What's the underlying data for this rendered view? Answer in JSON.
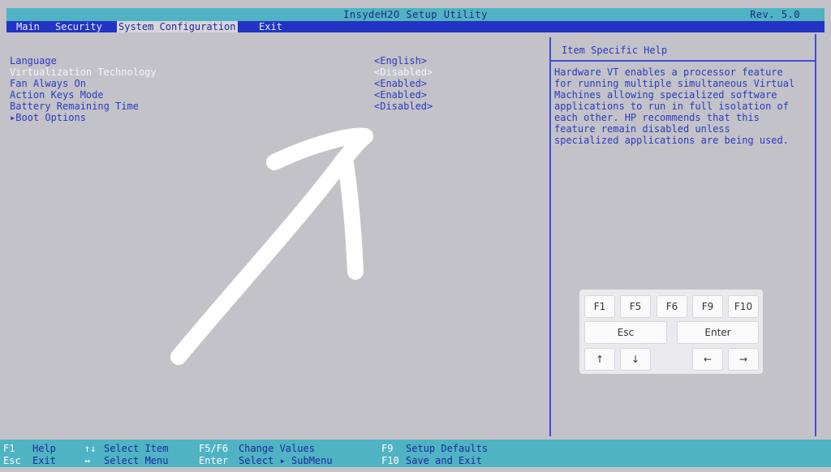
{
  "window": {
    "title": "InsydeH2O Setup Utility",
    "revision": "Rev. 5.0"
  },
  "menu": {
    "items": [
      {
        "label": "Main"
      },
      {
        "label": "Security"
      },
      {
        "label": "System Configuration"
      },
      {
        "label": "Exit"
      }
    ]
  },
  "settings": {
    "rows": [
      {
        "label": "Language",
        "value": "<English>"
      },
      {
        "label": "Virtualization Technology",
        "value": "<Disabled>"
      },
      {
        "label": "Fan Always On",
        "value": "<Enabled>"
      },
      {
        "label": "Action Keys Mode",
        "value": "<Enabled>"
      },
      {
        "label": "Battery Remaining Time",
        "value": "<Disabled>"
      },
      {
        "label": "▸Boot Options",
        "value": ""
      }
    ]
  },
  "help": {
    "title": "Item Specific Help",
    "lines": [
      "Hardware VT enables a processor feature",
      "for running multiple simultaneous Virtual",
      "Machines allowing specialized software",
      "applications to run in full isolation of",
      "each other. HP recommends that this",
      "feature remain disabled unless",
      "specialized applications are being used."
    ]
  },
  "footer": {
    "items": [
      {
        "key": "F1",
        "desc": "Help"
      },
      {
        "key": "Esc",
        "desc": "Exit"
      },
      {
        "key": "↑↓",
        "desc": "Select Item"
      },
      {
        "key": "↔",
        "desc": "Select Menu"
      },
      {
        "key": "F5/F6",
        "desc": "Change Values"
      },
      {
        "key": "Enter",
        "desc": "Select ▸ SubMenu"
      },
      {
        "key": "F9",
        "desc": "Setup Defaults"
      },
      {
        "key": "F10",
        "desc": "Save and Exit"
      }
    ]
  },
  "onscreen_keyboard": {
    "keys": [
      "F1",
      "F5",
      "F6",
      "F9",
      "F10",
      "Esc",
      "Enter",
      "↑",
      "↓",
      "←",
      "→"
    ]
  },
  "colors": {
    "title_bar": "#4fb3c4",
    "menu_bar": "#2333c4",
    "background": "#c3c2c8",
    "text": "#2a3ac0",
    "highlight_text": "#f3f4ff"
  }
}
